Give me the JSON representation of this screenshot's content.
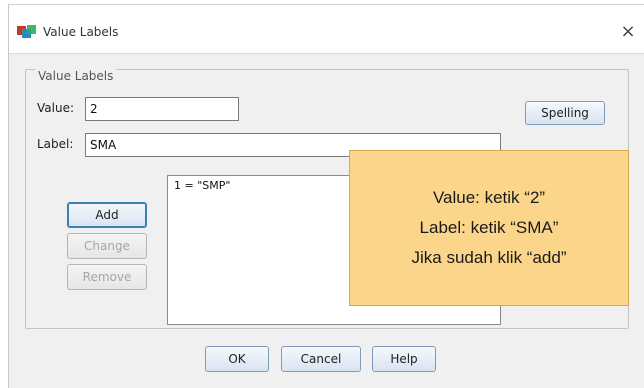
{
  "window": {
    "title": "Value Labels",
    "close_glyph": "×",
    "icon": "spss-app-icon"
  },
  "group": {
    "legend": "Value Labels"
  },
  "value": {
    "label": "Value:",
    "input": "2"
  },
  "label": {
    "label": "Label:",
    "input": "SMA"
  },
  "buttons": {
    "spelling": "Spelling",
    "add": "Add",
    "change": "Change",
    "remove": "Remove",
    "ok": "OK",
    "cancel": "Cancel",
    "help": "Help"
  },
  "list": {
    "items": [
      "1 = \"SMP\""
    ]
  },
  "note": {
    "line1": "Value: ketik “2”",
    "line2": "Label: ketik “SMA”",
    "line3": "Jika sudah klik “add”"
  },
  "colors": {
    "note_bg": "#fbd68a",
    "button_border": "#7f9db9",
    "focus": "#3c7fb1"
  }
}
